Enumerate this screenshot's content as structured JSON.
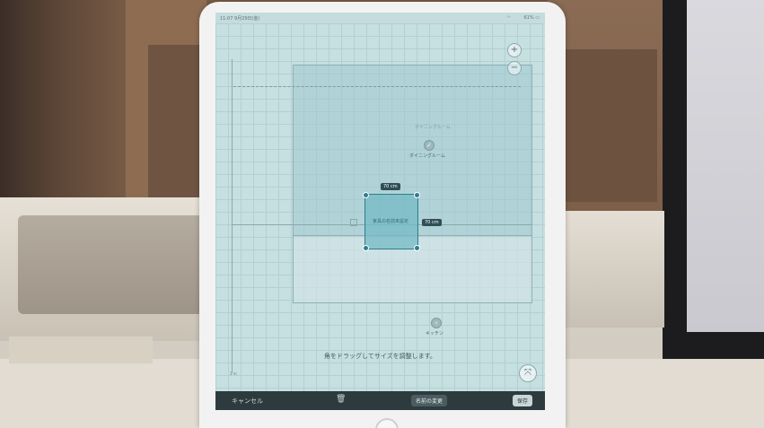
{
  "status_bar": {
    "time": "11:07",
    "date": "9月29日(金)",
    "battery": "61%"
  },
  "plan": {
    "room_labels": {
      "dining_room_faded": "ダイニングルーム",
      "dining_room": "ダイニングルーム",
      "kitchen": "キッチン",
      "selection": "家具の名前未設定"
    },
    "dimensions": {
      "width": "70 cm",
      "height": "70 cm"
    },
    "hint": "角をドラッグしてサイズを調整します。",
    "scale": "1 m"
  },
  "controls": {
    "zoom_in_icon": "+",
    "zoom_out_icon": "−",
    "fit_icon": "⤧"
  },
  "toolbar": {
    "cancel": "キャンセル",
    "rename": "名前の変更",
    "save": "保存"
  },
  "colors": {
    "plan_bg": "#c6dfe1",
    "selection": "#74bac4",
    "toolbar": "#2e3b3e"
  }
}
